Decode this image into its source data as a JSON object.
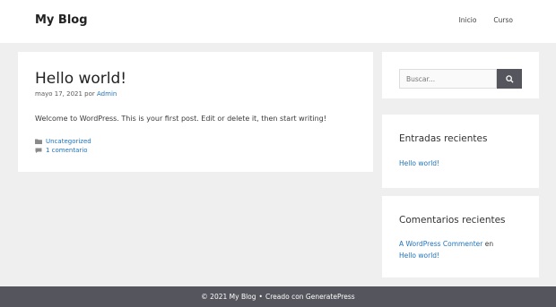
{
  "header": {
    "site_title": "My Blog",
    "nav": [
      {
        "label": "Inicio"
      },
      {
        "label": "Curso"
      }
    ]
  },
  "post": {
    "title": "Hello world!",
    "date": "mayo 17, 2021",
    "by": "por",
    "author": "Admin",
    "content": "Welcome to WordPress. This is your first post. Edit or delete it, then start writing!",
    "category": "Uncategorized",
    "comments": "1 comentario",
    "icons": {
      "category": "folder-icon",
      "comments": "comment-icon"
    }
  },
  "sidebar": {
    "search": {
      "placeholder": "Buscar...",
      "button_icon": "search-icon"
    },
    "recent_posts": {
      "title": "Entradas recientes",
      "items": [
        "Hello world!"
      ]
    },
    "recent_comments": {
      "title": "Comentarios recientes",
      "author": "A WordPress Commenter",
      "connector": "en",
      "post": "Hello world!"
    }
  },
  "footer": {
    "copyright": "© 2021 My Blog",
    "separator": "•",
    "credit": "Creado con GeneratePress"
  },
  "colors": {
    "link": "#1e73be",
    "footer_bg": "#55555e",
    "page_bg": "#efefef"
  }
}
